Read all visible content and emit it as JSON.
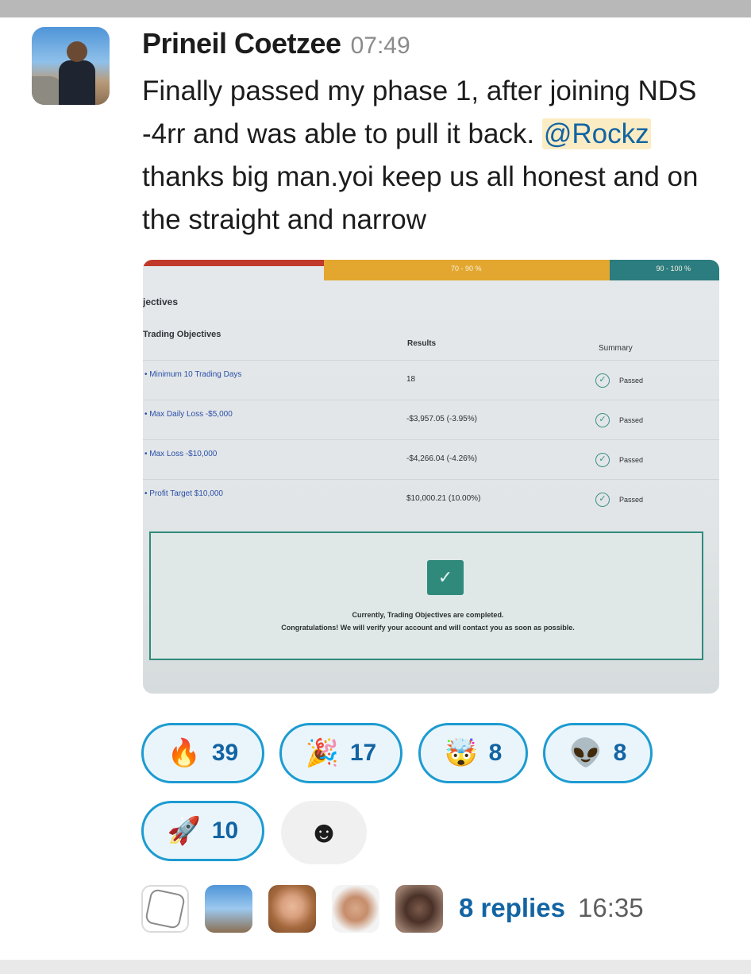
{
  "message": {
    "author": "Prineil Coetzee",
    "time": "07:49",
    "text_before": "Finally passed my phase 1, after joining NDS -4rr and was able to pull it back.",
    "mention": "@Rockz",
    "text_after": "thanks big man.yoi keep us all honest and on the straight and narrow"
  },
  "attachment": {
    "progress_labels": [
      "70 - 90 %",
      "90 - 100 %"
    ],
    "section_title": "jectives",
    "headers": [
      "Trading Objectives",
      "Results",
      "Summary"
    ],
    "rows": [
      {
        "objective": "• Minimum 10 Trading Days",
        "result": "18",
        "status": "Passed"
      },
      {
        "objective": "• Max Daily Loss -$5,000",
        "result": "-$3,957.05 (-3.95%)",
        "status": "Passed"
      },
      {
        "objective": "• Max Loss -$10,000",
        "result": "-$4,266.04 (-4.26%)",
        "status": "Passed"
      },
      {
        "objective": "• Profit Target $10,000",
        "result": "$10,000.21 (10.00%)",
        "status": "Passed"
      }
    ],
    "completion_line1": "Currently, Trading Objectives are completed.",
    "completion_line2": "Congratulations! We will verify your account and will contact you as soon as possible."
  },
  "reactions": [
    {
      "emoji": "🔥",
      "icon": "fire-icon",
      "count": "39"
    },
    {
      "emoji": "🎉",
      "icon": "party-popper-icon",
      "count": "17"
    },
    {
      "emoji": "🤯",
      "icon": "exploding-head-icon",
      "count": "8"
    },
    {
      "emoji": "👽",
      "icon": "alien-icon",
      "count": "8"
    },
    {
      "emoji": "🚀",
      "icon": "rocket-icon",
      "count": "10"
    }
  ],
  "add_reaction_icon": "☻",
  "thread": {
    "replies": "8 replies",
    "time": "16:35"
  },
  "colors": {
    "link": "#1264a3",
    "reaction_border": "#1d9bd1",
    "mention_bg": "#fbecc3"
  }
}
